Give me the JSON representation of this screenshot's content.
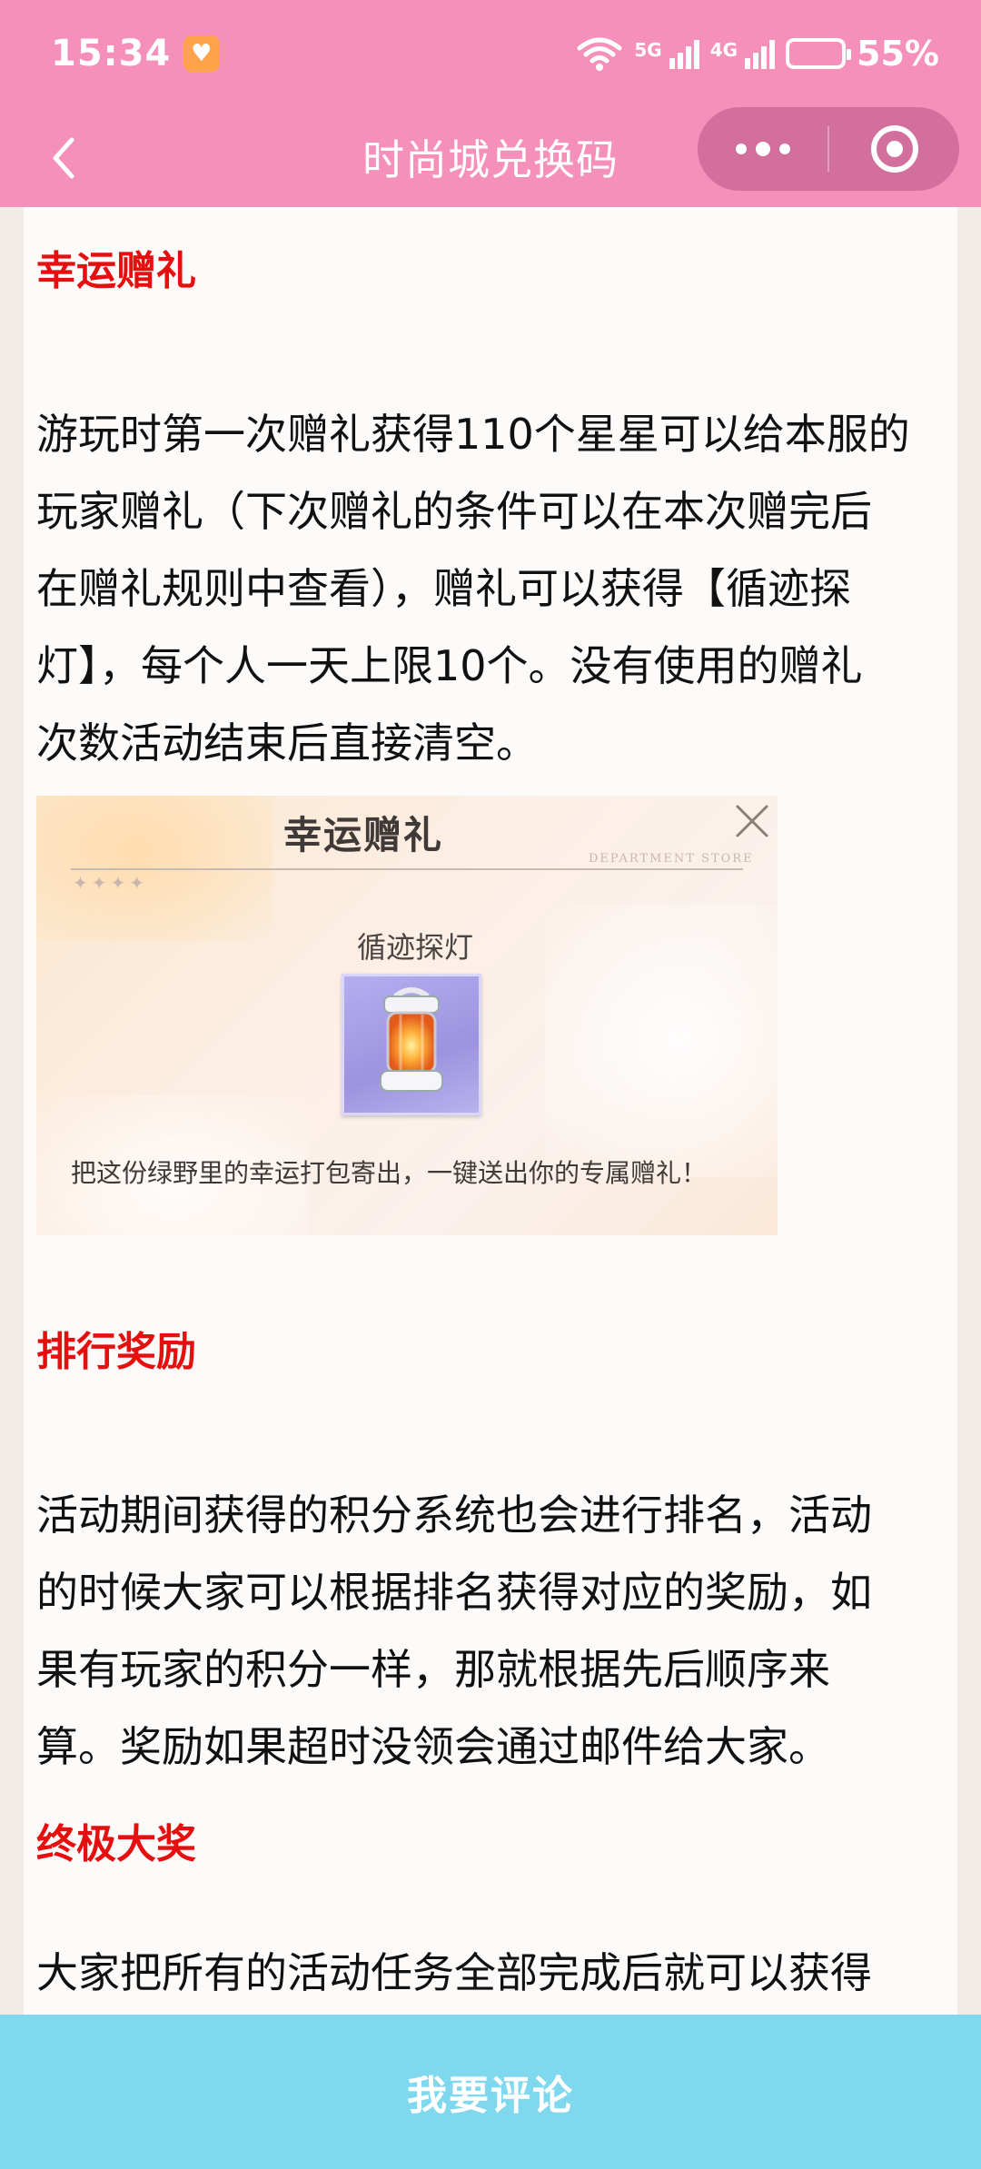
{
  "status_bar": {
    "time": "15:34",
    "signal1_label": "5G",
    "signal2_label": "4G",
    "battery": "55%"
  },
  "nav": {
    "title": "时尚城兑换码"
  },
  "article": {
    "section1_title": "幸运赠礼",
    "section1_lines": [
      "游玩时第一次赠礼获得110个星星可以给本服的",
      "玩家赠礼（下次赠礼的条件可以在本次赠完后",
      "在赠礼规则中查看），赠礼可以获得【循迹探",
      "灯】，每个人一天上限10个。没有使用的赠礼",
      "次数活动结束后直接清空。"
    ],
    "image": {
      "title": "幸运赠礼",
      "store_label": "DEPARTMENT STORE",
      "stars": "✦✦✦✦",
      "item_name": "循迹探灯",
      "caption": "把这份绿野里的幸运打包寄出，一键送出你的专属赠礼！"
    },
    "section2_title": "排行奖励",
    "section2_lines": [
      "活动期间获得的积分系统也会进行排名，活动",
      "的时候大家可以根据排名获得对应的奖励，如",
      "果有玩家的积分一样，那就根据先后顺序来",
      "算。奖励如果超时没领会通过邮件给大家。"
    ],
    "section3_title": "终极大奖",
    "section3_lines": [
      "大家把所有的活动任务全部完成后就可以获得"
    ]
  },
  "comment_button": {
    "label": "我要评论"
  },
  "colors": {
    "header_pink": "#f590bb",
    "title_red": "#e60f0f",
    "comment_blue": "#7fd8ee"
  }
}
